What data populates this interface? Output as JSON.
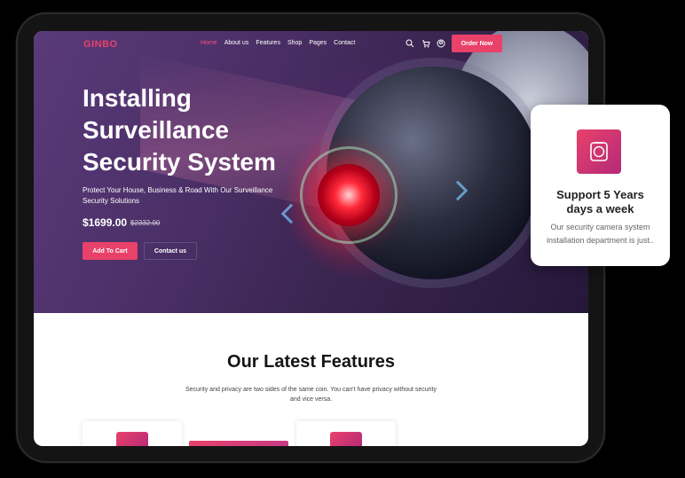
{
  "brand": {
    "logo_mark": "G",
    "logo_text": "INBO",
    "accent_color": "#e8416a"
  },
  "nav": {
    "items": [
      {
        "label": "Home",
        "active": true
      },
      {
        "label": "About us",
        "active": false
      },
      {
        "label": "Features",
        "active": false
      },
      {
        "label": "Shop",
        "active": false
      },
      {
        "label": "Pages",
        "active": false
      },
      {
        "label": "Contact",
        "active": false
      }
    ],
    "icons": [
      "search-icon",
      "cart-icon",
      "user-icon"
    ],
    "cta_label": "Order Now"
  },
  "hero": {
    "title_line1": "Installing",
    "title_line2": "Surveillance",
    "title_line3": "Security System",
    "subtitle": "Protect Your House, Business & Road With Our Surveillance Security Solutions",
    "price": "$1699.00",
    "old_price": "$2332.00",
    "primary_button": "Add To Cart",
    "secondary_button": "Contact us"
  },
  "features": {
    "title": "Our Latest Features",
    "subtitle": "Security and privacy are two sides of the same coin. You can't have privacy without security and vice versa."
  },
  "support_card": {
    "icon": "support-24-icon",
    "title_line1": "Support 5 Years",
    "title_line2": "days a week",
    "text": "Our security camera system installation department is just.."
  }
}
